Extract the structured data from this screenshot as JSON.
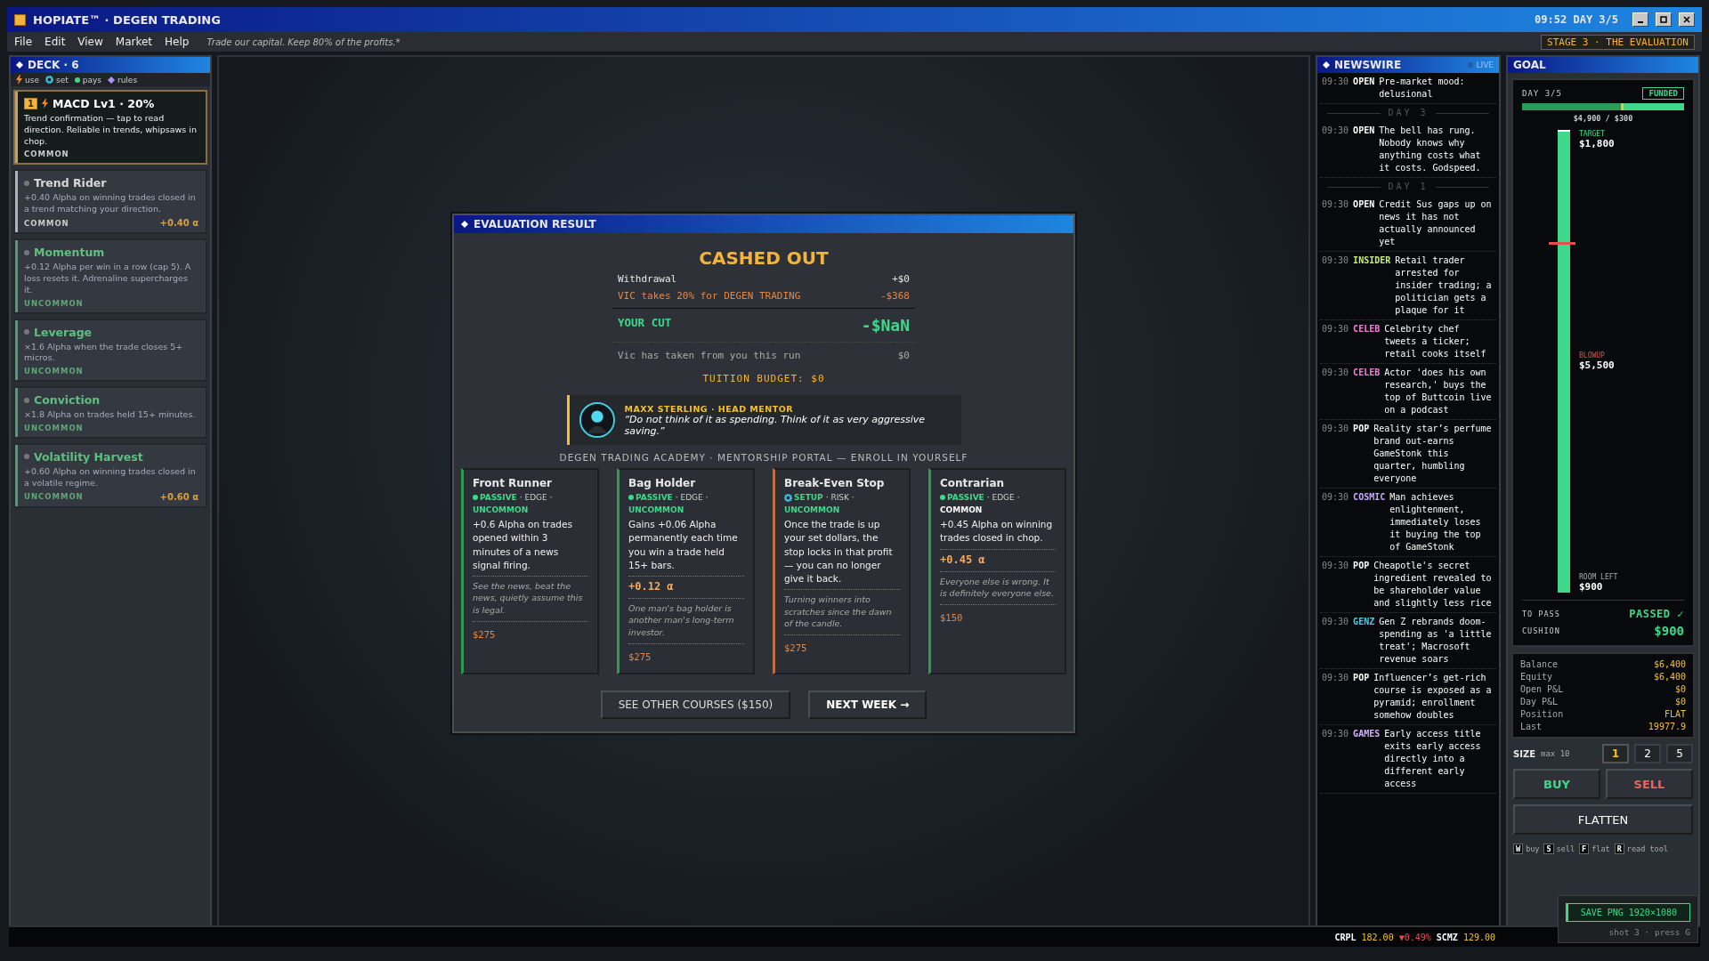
{
  "window": {
    "title": "HOPIATE™ · DEGEN TRADING",
    "clock": "09:52 DAY 3/5"
  },
  "menu": {
    "items": [
      "File",
      "Edit",
      "View",
      "Market",
      "Help"
    ],
    "tagline": "Trade our capital. Keep 80% of the profits.*",
    "stage": "STAGE 3 · THE EVALUATION"
  },
  "deck": {
    "title": "DECK · 6",
    "legend": [
      {
        "kind": "use",
        "label": "use"
      },
      {
        "kind": "set",
        "label": "set"
      },
      {
        "kind": "pays",
        "label": "pays"
      },
      {
        "kind": "rules",
        "label": "rules"
      }
    ],
    "cards": [
      {
        "name": "MACD Lv1 · 20%",
        "slot": "1",
        "desc": "Trend confirmation — tap to read direction. Reliable in trends, whipsaws in chop.",
        "rarity": "COMMON",
        "color": "#c8a060",
        "selected": true
      },
      {
        "name": "Trend Rider",
        "desc": "+0.40 Alpha on winning trades closed in a trend matching your direction.",
        "rarity": "COMMON",
        "bonus": "+0.40 α",
        "color": "#b0b4bc",
        "selected": false
      },
      {
        "name": "Momentum",
        "desc": "+0.12 Alpha per win in a row (cap 5). A loss resets it. Adrenaline supercharges it.",
        "rarity": "UNCOMMON",
        "color": "#4ea070",
        "selected": false
      },
      {
        "name": "Leverage",
        "desc": "×1.6 Alpha when the trade closes 5+ micros.",
        "rarity": "UNCOMMON",
        "color": "#4ea070",
        "selected": false
      },
      {
        "name": "Conviction",
        "desc": "×1.8 Alpha on trades held 15+ minutes.",
        "rarity": "UNCOMMON",
        "color": "#4ea070",
        "selected": false
      },
      {
        "name": "Volatility Harvest",
        "desc": "+0.60 Alpha on winning trades closed in a volatile regime.",
        "rarity": "UNCOMMON",
        "bonus": "+0.60 α",
        "color": "#4ea070",
        "selected": false
      }
    ]
  },
  "modal": {
    "title": "EVALUATION RESULT",
    "heading": "CASHED OUT",
    "rows": [
      {
        "kind": "normal",
        "label": "Withdrawal",
        "value": "+$0"
      },
      {
        "kind": "fee",
        "label": "VIC takes 20% for DEGEN TRADING",
        "value": "-$368"
      },
      {
        "kind": "total",
        "label": "YOUR CUT",
        "value": "-$NaN"
      },
      {
        "kind": "muted",
        "label": "Vic has taken from you this run",
        "value": "$0"
      }
    ],
    "budget": "TUITION BUDGET: $0",
    "mentor": {
      "name": "MAXX STERLING · HEAD MENTOR",
      "quote": "“Do not think of it as spending. Think of it as very aggressive saving.”"
    },
    "academy": "DEGEN TRADING ACADEMY · MENTORSHIP PORTAL — ENROLL IN YOURSELF",
    "courses": [
      {
        "name": "Front Runner",
        "kind": "passive",
        "type": "PASSIVE",
        "category": "· EDGE ·",
        "rarity": "UNCOMMON",
        "desc": "+0.6 Alpha on trades opened within 3 minutes of a news signal firing.",
        "flavor": "See the news, beat the news, quietly assume this is legal.",
        "price": "$275",
        "color": "#2e9a4c"
      },
      {
        "name": "Bag Holder",
        "kind": "passive",
        "type": "PASSIVE",
        "category": "· EDGE ·",
        "rarity": "UNCOMMON",
        "desc": "Gains +0.06 Alpha permanently each time you win a trade held 15+ bars.",
        "bonus": "+0.12 α",
        "flavor": "One man's bag holder is another man's long-term investor.",
        "price": "$275",
        "color": "#2e9a4c"
      },
      {
        "name": "Break-Even Stop",
        "kind": "setup",
        "type": "SETUP",
        "category": "· RISK ·",
        "rarity": "UNCOMMON",
        "desc": "Once the trade is up your set dollars, the stop locks in that profit — you can no longer give it back.",
        "flavor": "Turning winners into scratches since the dawn of the candle.",
        "price": "$275",
        "color": "#b87040"
      },
      {
        "name": "Contrarian",
        "kind": "passive",
        "type": "PASSIVE",
        "category": "· EDGE ·",
        "rarity": "COMMON",
        "desc": "+0.45 Alpha on winning trades closed in chop.",
        "bonus": "+0.45 α",
        "flavor": "Everyone else is wrong. It is definitely everyone else.",
        "price": "$150",
        "color": "#2e9a4c"
      }
    ],
    "buttons": [
      {
        "kind": "secondary",
        "label": "SEE OTHER COURSES ($150)"
      },
      {
        "kind": "primary",
        "label": "NEXT WEEK →"
      }
    ]
  },
  "news": {
    "title": "NEWSWIRE",
    "live": "LIVE",
    "items": [
      {
        "kind": "news",
        "time": "09:30",
        "tag": "OPEN",
        "color": "#ffffff",
        "text": "Pre-market mood: delusional"
      },
      {
        "kind": "divider",
        "text": "DAY 3"
      },
      {
        "kind": "news",
        "time": "09:30",
        "tag": "OPEN",
        "color": "#ffffff",
        "text": "The bell has rung. Nobody knows why anything costs what it costs. Godspeed."
      },
      {
        "kind": "divider",
        "text": "DAY 1"
      },
      {
        "kind": "news",
        "time": "09:30",
        "tag": "OPEN",
        "color": "#ffffff",
        "text": "Credit Sus gaps up on news it has not actually announced yet"
      },
      {
        "kind": "news",
        "time": "09:30",
        "tag": "INSIDER",
        "color": "#c8f070",
        "text": "Retail trader arrested for insider trading; a politician gets a plaque for it"
      },
      {
        "kind": "news",
        "time": "09:30",
        "tag": "CELEB",
        "color": "#f080d8",
        "text": "Celebrity chef tweets a ticker; retail cooks itself"
      },
      {
        "kind": "news",
        "time": "09:30",
        "tag": "CELEB",
        "color": "#f080d8",
        "text": "Actor 'does his own research,' buys the top of Buttcoin live on a podcast"
      },
      {
        "kind": "news",
        "time": "09:30",
        "tag": "POP",
        "color": "#ffffff",
        "text": "Reality star’s perfume brand out-earns GameStonk this quarter, humbling everyone"
      },
      {
        "kind": "news",
        "time": "09:30",
        "tag": "COSMIC",
        "color": "#c8a8ff",
        "text": "Man achieves enlightenment, immediately loses it buying the top of GameStonk"
      },
      {
        "kind": "news",
        "time": "09:30",
        "tag": "POP",
        "color": "#ffffff",
        "text": "Cheapotle's secret ingredient revealed to be shareholder value and slightly less rice"
      },
      {
        "kind": "news",
        "time": "09:30",
        "tag": "GENZ",
        "color": "#40d0f0",
        "text": "Gen Z rebrands doom-spending as 'a little treat'; Macrosoft revenue soars"
      },
      {
        "kind": "news",
        "time": "09:30",
        "tag": "POP",
        "color": "#ffffff",
        "text": "Influencer’s get-rich course is exposed as a pyramid; enrollment somehow doubles"
      },
      {
        "kind": "news",
        "time": "09:30",
        "tag": "GAMES",
        "color": "#d0b0ff",
        "text": "Early access title exits early access directly into a different early access"
      }
    ]
  },
  "goal": {
    "title": "GOAL",
    "day": "DAY 3/5",
    "badge": "FUNDED",
    "progress": {
      "level": 0.61
    },
    "progress_label": "$4,900 / $300",
    "meter": {
      "level": 1
    },
    "marks": [
      {
        "kind": "target",
        "label": "TARGET",
        "value": "$1,800"
      },
      {
        "kind": "blowup",
        "label": "BLOWUP",
        "value": "$5,500"
      },
      {
        "kind": "room",
        "label": "ROOM LEFT",
        "value": "$900"
      }
    ],
    "pass": [
      {
        "kind": "status",
        "label": "TO PASS",
        "value": "PASSED ✓"
      },
      {
        "kind": "money",
        "label": "CUSHION",
        "value": "$900"
      }
    ]
  },
  "stats": [
    {
      "label": "Balance",
      "value": "$6,400"
    },
    {
      "label": "Equity",
      "value": "$6,400"
    },
    {
      "label": "Open P&L",
      "value": "$0"
    },
    {
      "label": "Day P&L",
      "value": "$0"
    },
    {
      "label": "Position",
      "value": "FLAT"
    },
    {
      "label": "Last",
      "value": "19977.9"
    }
  ],
  "size": {
    "label": "SIZE",
    "hint": "max 10",
    "options": [
      {
        "label": "1",
        "selected": true
      },
      {
        "label": "2",
        "selected": false
      },
      {
        "label": "5",
        "selected": false
      }
    ]
  },
  "actions": [
    {
      "kind": "buy",
      "label": "BUY"
    },
    {
      "kind": "sell",
      "label": "SELL"
    },
    {
      "kind": "flatten",
      "label": "FLATTEN"
    }
  ],
  "keys": [
    {
      "key": "W",
      "label": "buy"
    },
    {
      "key": "S",
      "label": "sell"
    },
    {
      "key": "F",
      "label": "flat"
    },
    {
      "key": "R",
      "label": "read tool"
    }
  ],
  "tickers": [
    {
      "symbol": "CRPL",
      "price": "182.00",
      "change": "▼0.49%"
    },
    {
      "symbol": "SCMZ",
      "price": "129.00"
    }
  ],
  "capture": {
    "button": "SAVE PNG 1920×1080",
    "hint": "shot 3 · press G"
  }
}
